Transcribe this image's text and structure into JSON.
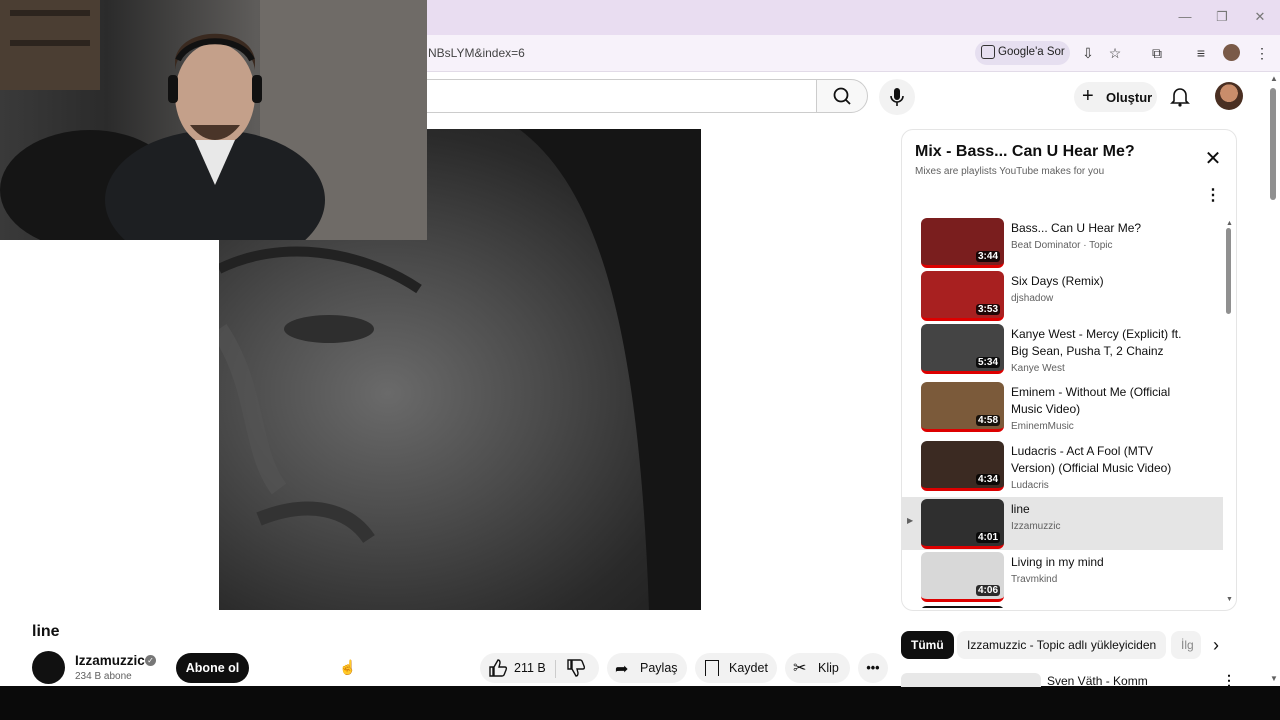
{
  "browser": {
    "url": "NBsLYM&index=6",
    "google_search_label": "Google'a Sor"
  },
  "header": {
    "create_label": "Oluştur"
  },
  "video": {
    "title": "line",
    "channel": "Izzamuzzic",
    "subscribers": "234 B abone",
    "subscribe_label": "Abone ol",
    "likes": "211 B",
    "share_label": "Paylaş",
    "save_label": "Kaydet",
    "clip_label": "Klip"
  },
  "playlist": {
    "title": "Mix - Bass... Can U Hear Me?",
    "subtitle": "Mixes are playlists YouTube makes for you",
    "items": [
      {
        "title": "Bass... Can U Hear Me?",
        "channel": "Beat Dominator · Topic",
        "duration": "3:44",
        "color": "#7a1e1e"
      },
      {
        "title": "Six Days (Remix)",
        "channel": "djshadow",
        "duration": "3:53",
        "color": "#a82020"
      },
      {
        "title": "Kanye West - Mercy (Explicit) ft. Big Sean, Pusha T, 2 Chainz",
        "channel": "Kanye West",
        "duration": "5:34",
        "color": "#444444"
      },
      {
        "title": "Eminem - Without Me (Official Music Video)",
        "channel": "EminemMusic",
        "duration": "4:58",
        "color": "#7b5a3a"
      },
      {
        "title": "Ludacris - Act A Fool (MTV Version) (Official Music Video)",
        "channel": "Ludacris",
        "duration": "4:34",
        "color": "#3b2a22"
      },
      {
        "title": "line",
        "channel": "Izzamuzzic",
        "duration": "4:01",
        "color": "#2f2f2f",
        "playing_marker": "▶"
      },
      {
        "title": "Living in my mind",
        "channel": "Travmkind",
        "duration": "4:06",
        "color": "#d8d8d8"
      }
    ]
  },
  "chips": [
    "Tümü",
    "Izzamuzzic - Topic adlı yükleyiciden",
    "İlg"
  ],
  "recommendation": {
    "title": "Sven Väth - Komm"
  }
}
